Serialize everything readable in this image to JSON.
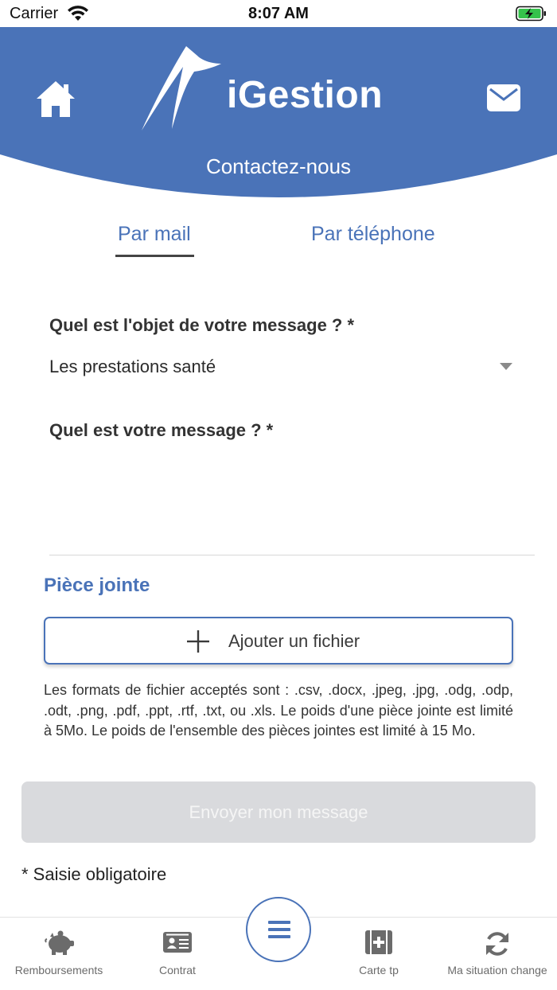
{
  "status_bar": {
    "carrier": "Carrier",
    "time": "8:07 AM"
  },
  "header": {
    "logo_text": "iGestion",
    "title": "Contactez-nous",
    "brand_color": "#4a73b8"
  },
  "tabs": [
    {
      "label": "Par mail",
      "active": true
    },
    {
      "label": "Par téléphone",
      "active": false
    }
  ],
  "form": {
    "object_label": "Quel est l'objet de votre message ? *",
    "object_value": "Les prestations santé",
    "message_label": "Quel est votre message ? *",
    "message_value": ""
  },
  "attachment": {
    "title": "Pièce jointe",
    "add_label": "Ajouter un fichier",
    "formats_text": "Les formats de fichier acceptés sont : .csv, .docx, .jpeg, .jpg, .odg, .odp, .odt, .png, .pdf, .ppt, .rtf, .txt, ou .xls. Le poids d'une pièce jointe est limité à 5Mo. Le poids de l'ensemble des pièces jointes est limité à 15 Mo."
  },
  "send_label": "Envoyer mon message",
  "required_note": "* Saisie obligatoire",
  "bottom_nav": {
    "items": [
      {
        "label": "Remboursements",
        "icon": "piggy-bank-icon"
      },
      {
        "label": "Contrat",
        "icon": "id-card-icon"
      },
      {
        "label": "Carte tp",
        "icon": "medical-card-icon"
      },
      {
        "label": "Ma situation change",
        "icon": "refresh-icon"
      }
    ],
    "menu_icon": "hamburger-menu-icon"
  }
}
